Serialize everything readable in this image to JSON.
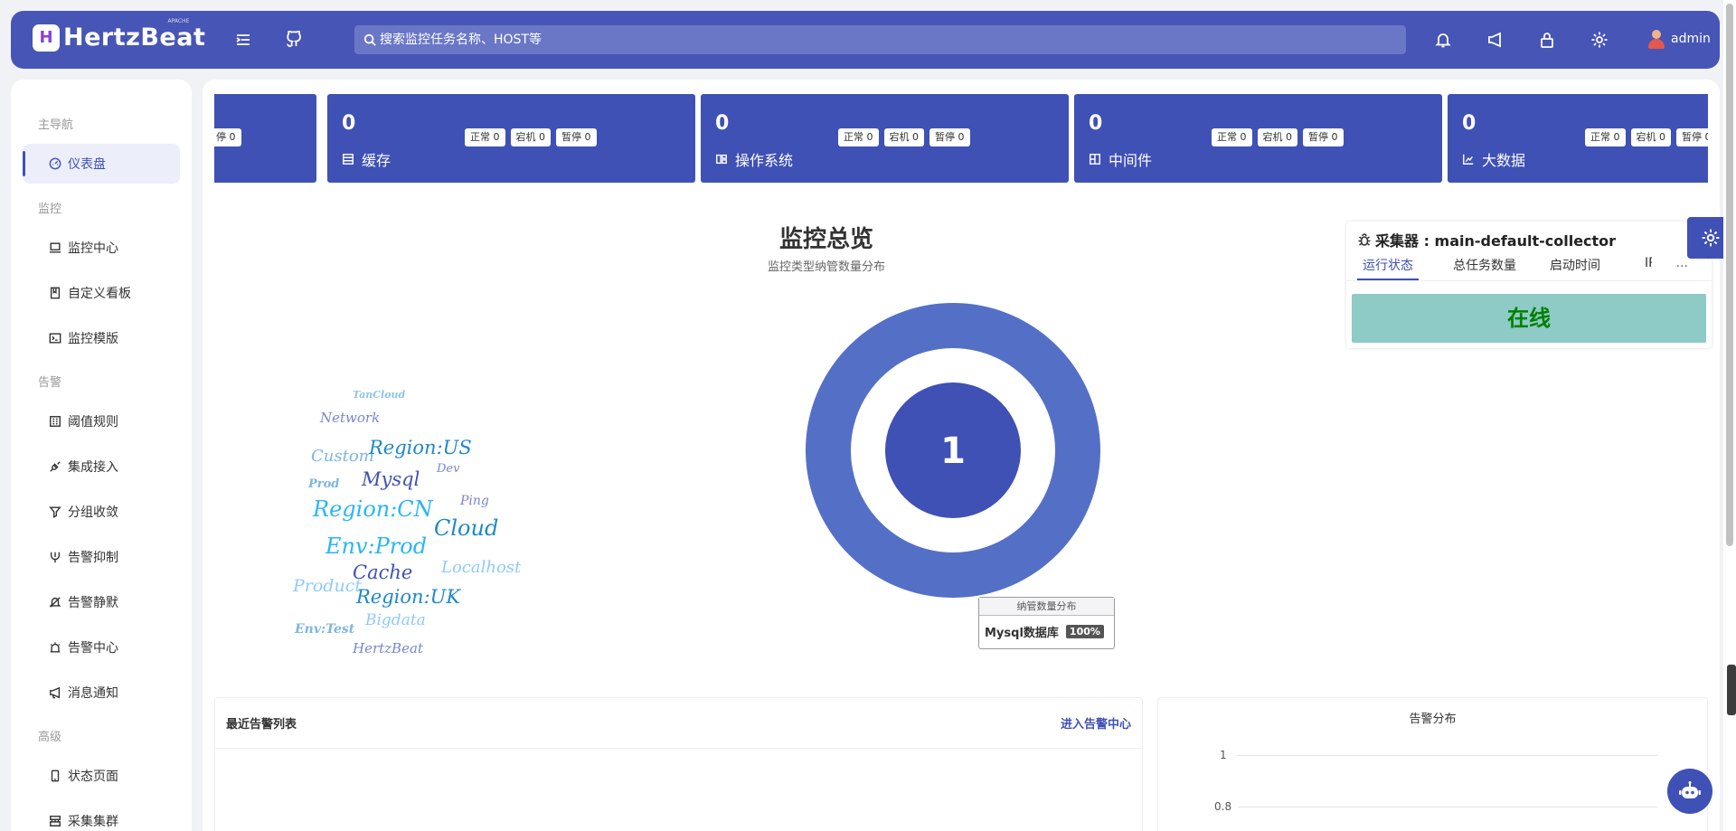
{
  "header": {
    "logo_text": "HertzBeat",
    "logo_sub": "APACHE",
    "logo_mark": "H",
    "search_placeholder": "搜索监控任务名称、HOST等",
    "username": "admin"
  },
  "sidebar": {
    "groups": {
      "main": "主导航",
      "monitor": "监控",
      "alert": "告警",
      "advanced": "高级"
    },
    "items": [
      {
        "label": "仪表盘",
        "icon": "dashboard-icon"
      },
      {
        "label": "监控中心",
        "icon": "laptop-icon"
      },
      {
        "label": "自定义看板",
        "icon": "book-icon"
      },
      {
        "label": "监控模版",
        "icon": "code-icon"
      },
      {
        "label": "阈值规则",
        "icon": "calculator-icon"
      },
      {
        "label": "集成接入",
        "icon": "api-icon"
      },
      {
        "label": "分组收敛",
        "icon": "filter-icon"
      },
      {
        "label": "告警抑制",
        "icon": "fork-icon"
      },
      {
        "label": "告警静默",
        "icon": "mute-icon"
      },
      {
        "label": "告警中心",
        "icon": "alarm-icon"
      },
      {
        "label": "消息通知",
        "icon": "notification-icon"
      },
      {
        "label": "状态页面",
        "icon": "mobile-icon"
      },
      {
        "label": "采集集群",
        "icon": "cluster-icon"
      }
    ]
  },
  "cards": [
    {
      "num": "",
      "label": "",
      "tags": [
        "停 0"
      ]
    },
    {
      "num": "0",
      "label": "缓存",
      "icon": "database-icon",
      "tags": [
        "正常 0",
        "宕机 0",
        "暂停 0"
      ]
    },
    {
      "num": "0",
      "label": "操作系统",
      "icon": "os-icon",
      "tags": [
        "正常 0",
        "宕机 0",
        "暂停 0"
      ]
    },
    {
      "num": "0",
      "label": "中间件",
      "icon": "middleware-icon",
      "tags": [
        "正常 0",
        "宕机 0",
        "暂停 0"
      ]
    },
    {
      "num": "0",
      "label": "大数据",
      "icon": "bigdata-icon",
      "tags": [
        "正常 0",
        "宕机 0",
        "暂停 0"
      ]
    }
  ],
  "overview": {
    "title": "监控总览",
    "subtitle": "监控类型纳管数量分布",
    "center_value": "1",
    "tooltip_title": "纳管数量分布",
    "tooltip_label": "Mysql数据库",
    "tooltip_pct": "100%"
  },
  "tag_cloud": [
    "TanCloud",
    "Network",
    "Custom",
    "Region:US",
    "Dev",
    "Prod",
    "Mysql",
    "Ping",
    "Region:CN",
    "Cloud",
    "Env:Prod",
    "Localhost",
    "Cache",
    "Product",
    "Region:UK",
    "Bigdata",
    "Env:Test",
    "HertzBeat"
  ],
  "collector": {
    "title": "采集器 : main-default-collector",
    "tabs": [
      "运行状态",
      "总任务数量",
      "启动时间",
      "IP"
    ],
    "more": "···",
    "status": "在线"
  },
  "alerts_panel": {
    "title": "最近告警列表",
    "link": "进入告警中心"
  },
  "dist_panel": {
    "title": "告警分布",
    "y_ticks": [
      "1",
      "0.8"
    ]
  },
  "chart_data": {
    "type": "pie",
    "title": "监控总览",
    "subtitle": "监控类型纳管数量分布",
    "categories": [
      "Mysql数据库"
    ],
    "values": [
      1
    ],
    "percent": [
      100
    ]
  },
  "colors": {
    "primary": "#3f51b5",
    "header": "#4655b6",
    "donut_outer": "#5470c6",
    "status_bg": "#8ecac6",
    "status_text": "#008000"
  }
}
